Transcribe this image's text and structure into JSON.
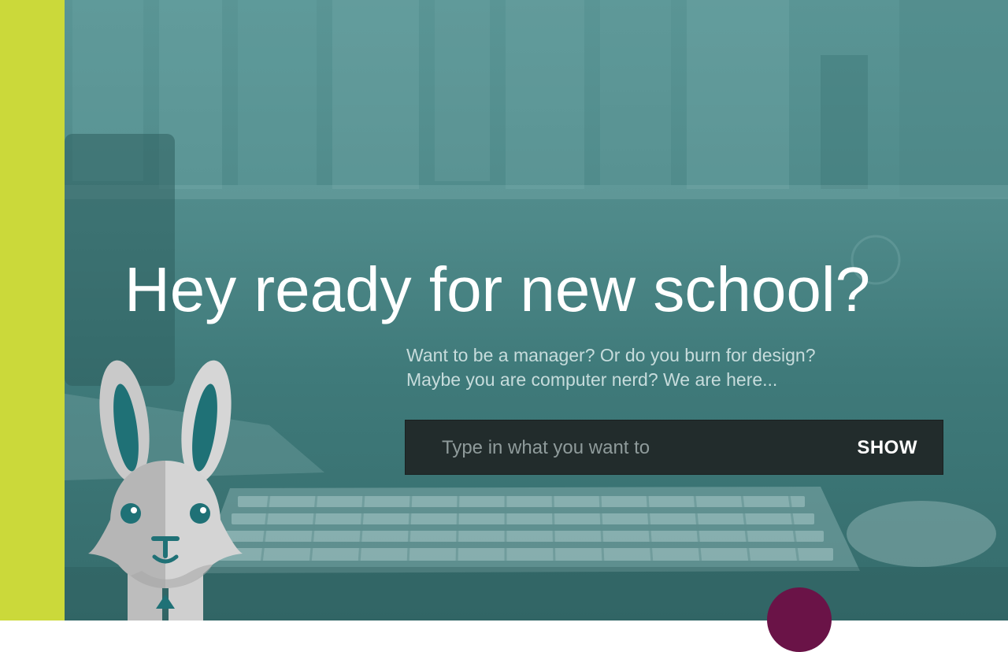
{
  "hero": {
    "headline": "Hey ready for new school?",
    "subline_1": "Want to be a manager? Or do you burn for design?",
    "subline_2": "Maybe you are computer nerd? We are here..."
  },
  "search": {
    "placeholder": "Type in what you want to",
    "value": "",
    "button_label": "SHOW"
  },
  "mascot": {
    "icon": "rabbit-mascot"
  },
  "colors": {
    "accent_lime": "#cbd93a",
    "overlay_teal": "#4b8585",
    "search_bg": "#222c2c",
    "circle_plum": "#6a1347",
    "mascot_teal": "#1f7176"
  }
}
